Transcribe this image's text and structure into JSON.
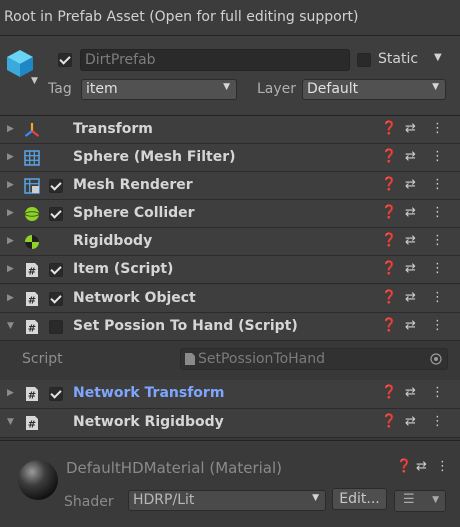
{
  "root_message": "Root in Prefab Asset (Open for full editing support)",
  "header": {
    "active": true,
    "name": "DirtPrefab",
    "static_label": "Static",
    "tag_label": "Tag",
    "tag_value": "item",
    "layer_label": "Layer",
    "layer_value": "Default"
  },
  "components": [
    {
      "name": "Transform",
      "icon": "transform-axis-icon",
      "has_checkbox": false,
      "expanded": false
    },
    {
      "name": "Sphere (Mesh Filter)",
      "icon": "mesh-grid-icon",
      "has_checkbox": false,
      "expanded": false
    },
    {
      "name": "Mesh Renderer",
      "icon": "mesh-renderer-icon",
      "has_checkbox": true,
      "checked": true,
      "expanded": false
    },
    {
      "name": "Sphere Collider",
      "icon": "sphere-collider-icon",
      "has_checkbox": true,
      "checked": true,
      "expanded": false
    },
    {
      "name": "Rigidbody",
      "icon": "rigidbody-icon",
      "has_checkbox": false,
      "expanded": false
    },
    {
      "name": "Item (Script)",
      "icon": "script-icon",
      "has_checkbox": true,
      "checked": true,
      "expanded": false
    },
    {
      "name": "Network Object",
      "icon": "script-icon",
      "has_checkbox": true,
      "checked": true,
      "expanded": false
    },
    {
      "name": "Set Possion To Hand (Script)",
      "icon": "script-icon",
      "has_checkbox": true,
      "checked": false,
      "expanded": true
    },
    {
      "name": "Network Transform",
      "icon": "script-icon",
      "has_checkbox": true,
      "checked": true,
      "expanded": false,
      "highlight": true
    },
    {
      "name": "Network Rigidbody",
      "icon": "script-icon",
      "has_checkbox": false,
      "expanded": true
    }
  ],
  "script_field": {
    "label": "Script",
    "value": "SetPossionToHand"
  },
  "material": {
    "title": "DefaultHDMaterial (Material)",
    "shader_label": "Shader",
    "shader_value": "HDRP/Lit",
    "edit_label": "Edit..."
  },
  "colors": {
    "panel_bg": "#383838",
    "header_bg": "#3e3e3e",
    "highlight_text": "#7fa6ff",
    "collider_green": "#8fd32a"
  }
}
